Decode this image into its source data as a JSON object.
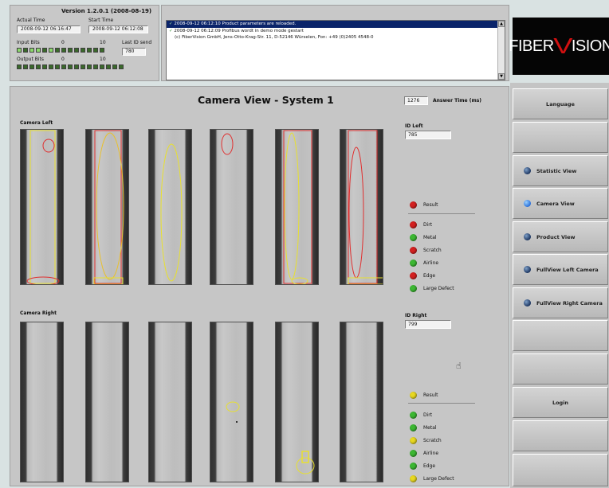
{
  "header": {
    "version": "Version 1.2.0.1 (2008-08-19)",
    "actual_time_label": "Actual Time",
    "actual_time_value": "2008-09-12 06:16:47",
    "start_time_label": "Start Time",
    "start_time_value": "2008-09-12 06:12:08",
    "input_bits_label": "Input Bits",
    "input_bits_left": "0",
    "input_bits_right": "10",
    "output_bits_label": "Output Bits",
    "output_bits_left": "0",
    "output_bits_right": "10",
    "last_id_label": "Last ID send",
    "last_id_value": "780"
  },
  "log": {
    "lines": [
      "2008-09-12 06:12:10 Product parameters are reloaded.",
      "2008-09-12 06:12:09 Profibus wordt in demo mode gestart",
      "(c) FiberVision GmbH, Jens-Otto-Krag-Str. 11, D-52146 Würselen, Fon: +49 (0)2405 4548-0"
    ]
  },
  "logo": {
    "left": "FIBER",
    "mid": "V",
    "right": "ISION"
  },
  "main": {
    "title": "Camera View - System 1",
    "answer_time_value": "1276",
    "answer_time_label": "Answer Time (ms)",
    "camera_left_label": "Camera Left",
    "camera_right_label": "Camera Right",
    "id_left_label": "ID Left",
    "id_left_value": "785",
    "id_right_label": "ID Right",
    "id_right_value": "799"
  },
  "results_left": [
    {
      "label": "Result",
      "color": "#d42020"
    },
    {
      "label": "Dirt",
      "color": "#d42020"
    },
    {
      "label": "Metal",
      "color": "#3cb832"
    },
    {
      "label": "Scratch",
      "color": "#d42020"
    },
    {
      "label": "Airline",
      "color": "#3cb832"
    },
    {
      "label": "Edge",
      "color": "#d42020"
    },
    {
      "label": "Large Defect",
      "color": "#3cb832"
    }
  ],
  "results_right": [
    {
      "label": "Result",
      "color": "#e8d820"
    },
    {
      "label": "Dirt",
      "color": "#3cb832"
    },
    {
      "label": "Metal",
      "color": "#3cb832"
    },
    {
      "label": "Scratch",
      "color": "#e8d820"
    },
    {
      "label": "Airline",
      "color": "#3cb832"
    },
    {
      "label": "Edge",
      "color": "#3cb832"
    },
    {
      "label": "Large Defect",
      "color": "#e8d820"
    }
  ],
  "sidebar": {
    "language": "Language",
    "statistic_view": "Statistic View",
    "camera_view": "Camera View",
    "product_view": "Product View",
    "fullview_left": "FullView Left Camera",
    "fullview_right": "FullView Right Camera",
    "login": "Login"
  },
  "colors": {
    "ok": "#3cb832",
    "fail": "#d42020",
    "warn": "#e8d820",
    "active_nav": "#2a6fd8",
    "logo_red": "#d01010"
  }
}
